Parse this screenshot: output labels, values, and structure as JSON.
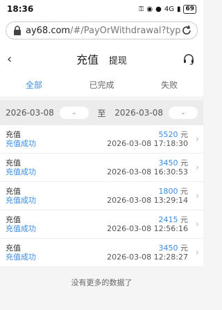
{
  "statusbar": {
    "time": "18:36",
    "signal": "4G",
    "battery": "69"
  },
  "browser": {
    "domain": "ay68.com",
    "path": "/#/PayOrWithdrawal?type"
  },
  "nav": {
    "title_active": "充值",
    "title_other": "提现"
  },
  "tabs": [
    {
      "label": "全部"
    },
    {
      "label": "已完成"
    },
    {
      "label": "失败"
    }
  ],
  "filter": {
    "start_date": "2026-03-08",
    "to_label": "至",
    "end_date": "2026-03-08"
  },
  "records": [
    {
      "type": "充值",
      "status": "充值成功",
      "amount": "5520",
      "unit": "元",
      "datetime": "2026-03-08 17:18:30"
    },
    {
      "type": "充值",
      "status": "充值成功",
      "amount": "3450",
      "unit": "元",
      "datetime": "2026-03-08 16:30:53"
    },
    {
      "type": "充值",
      "status": "充值成功",
      "amount": "1800",
      "unit": "元",
      "datetime": "2026-03-08 13:29:14"
    },
    {
      "type": "充值",
      "status": "充值成功",
      "amount": "2415",
      "unit": "元",
      "datetime": "2026-03-08 12:56:16"
    },
    {
      "type": "充值",
      "status": "充值成功",
      "amount": "3450",
      "unit": "元",
      "datetime": "2026-03-08 12:28:27"
    }
  ],
  "footer": {
    "text": "没有更多的数据了"
  },
  "colors": {
    "accent": "#3b8be0"
  }
}
